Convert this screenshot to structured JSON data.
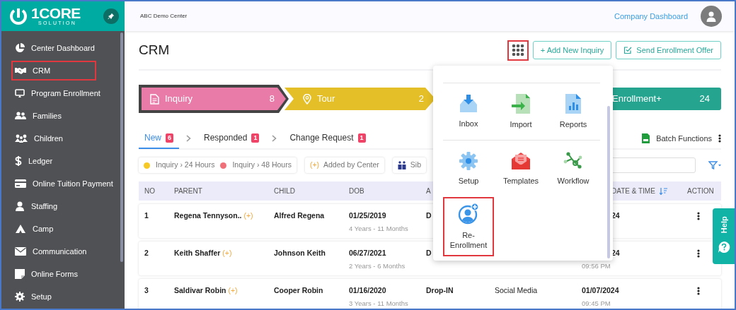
{
  "sidebar": {
    "logo": {
      "line1": "1CORE",
      "line2": "SOLUTION"
    },
    "items": [
      {
        "label": "Center Dashboard",
        "highlighted": false
      },
      {
        "label": "CRM",
        "highlighted": true
      },
      {
        "label": "Program Enrollment",
        "highlighted": false
      },
      {
        "label": "Families",
        "highlighted": false
      },
      {
        "label": "Children",
        "highlighted": false
      },
      {
        "label": "Ledger",
        "highlighted": false
      },
      {
        "label": "Online Tuition Payment",
        "highlighted": false
      },
      {
        "label": "Staffing",
        "highlighted": false
      },
      {
        "label": "Camp",
        "highlighted": false
      },
      {
        "label": "Communication",
        "highlighted": false
      },
      {
        "label": "Online Forms",
        "highlighted": false
      },
      {
        "label": "Setup",
        "highlighted": false
      }
    ]
  },
  "header": {
    "center": "ABC Demo Center",
    "link": "Company Dashboard"
  },
  "page": {
    "title": "CRM",
    "apps_button": {
      "highlighted": true
    },
    "add_button": "+ Add New Inquiry",
    "offer_button": "Send Enrollment Offer"
  },
  "stages": [
    {
      "label": "Inquiry",
      "count": "8",
      "color": "#e87ba8",
      "selected": true
    },
    {
      "label": "Tour",
      "count": "2",
      "color": "#e4bf27",
      "selected": false
    },
    {
      "label": "Enrollment+",
      "count": "24",
      "color": "#25a58f",
      "selected": false
    }
  ],
  "tabs": [
    {
      "label": "New",
      "count": "6",
      "selected": true
    },
    {
      "label": "Responded",
      "count": "1",
      "selected": false
    },
    {
      "label": "Change Request",
      "count": "1",
      "selected": false
    }
  ],
  "batch_functions": "Batch Functions",
  "legend": [
    {
      "kind": "dot",
      "color": "#f7c925",
      "label": "Inquiry › 24 Hours"
    },
    {
      "kind": "dot",
      "color": "#f0707a",
      "label": "Inquiry › 48 Hours"
    },
    {
      "kind": "tag",
      "mark": "(+)",
      "label": "Added by Center"
    },
    {
      "kind": "icon",
      "label": "Sib"
    }
  ],
  "table": {
    "columns": {
      "no": "NO",
      "parent": "PARENT",
      "child": "CHILD",
      "dob": "DOB",
      "column_5": "A",
      "date": "DATE & TIME",
      "action": "ACTION"
    },
    "date_header_covered": true,
    "rows": [
      {
        "no": "1",
        "parent": "Regena Tennyson..",
        "added": true,
        "child": "Alfred Regena",
        "dob": "01/25/2019",
        "age": "4 Years - 11 Months",
        "column_5": "D",
        "date": "24",
        "date_covered": true
      },
      {
        "no": "2",
        "parent": "Keith Shaffer",
        "added": true,
        "child": "Johnson Keith",
        "dob": "06/27/2021",
        "age": "2 Years - 6 Months",
        "column_5": "D",
        "date": "24",
        "date_covered": true,
        "time": "09:56 PM"
      },
      {
        "no": "3",
        "parent": "Saldivar Robin",
        "added": true,
        "child": "Cooper Robin",
        "dob": "01/16/2020",
        "age": "3 Years - 11 Months",
        "column_5": "Drop-IN",
        "column_6": "Social Media",
        "date": "01/07/2024",
        "date_covered": false,
        "time": "09:45 PM"
      }
    ]
  },
  "apps_menu": {
    "items": [
      {
        "label": "Inbox",
        "highlighted": false
      },
      {
        "label": "Import",
        "highlighted": false
      },
      {
        "label": "Reports",
        "highlighted": false
      },
      {
        "label": "Setup",
        "highlighted": false
      },
      {
        "label": "Templates",
        "highlighted": false
      },
      {
        "label": "Workflow",
        "highlighted": false
      },
      {
        "label": "Re-Enrollment",
        "highlighted": true
      }
    ]
  },
  "help": "Help"
}
